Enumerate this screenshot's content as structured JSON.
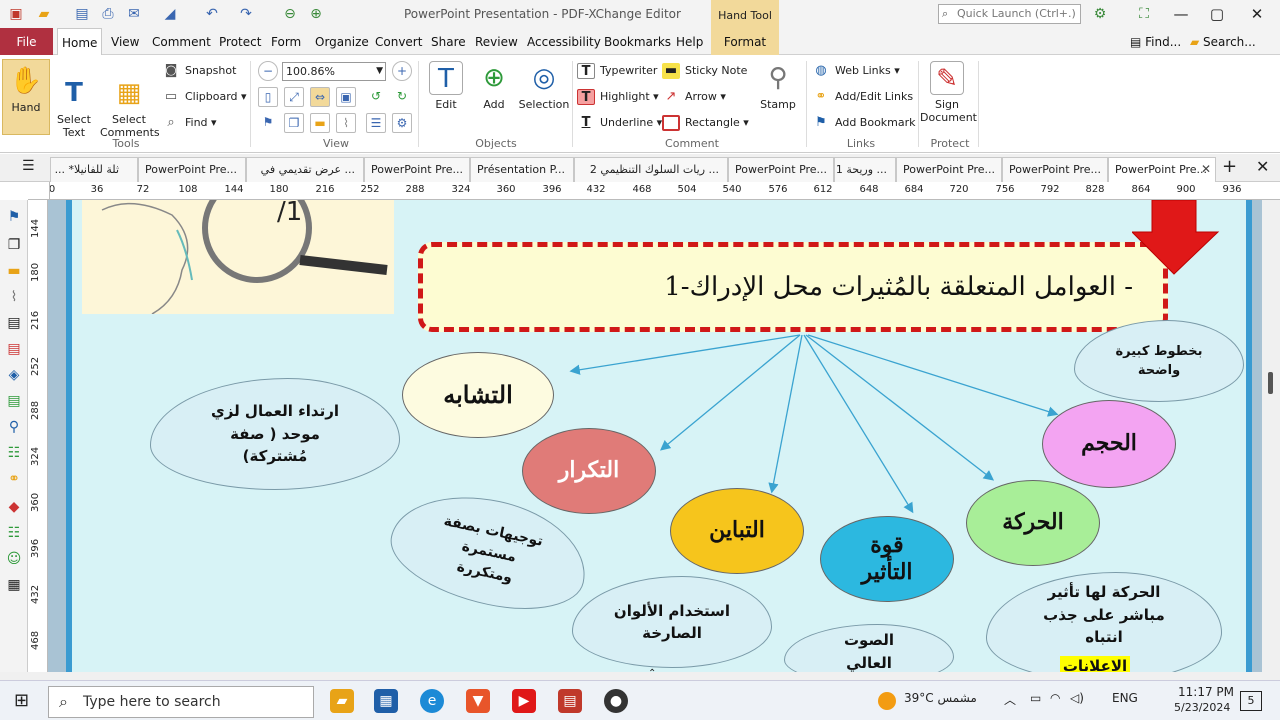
{
  "window": {
    "title": "PowerPoint Presentation - PDF-XChange Editor",
    "context_tab_header": "Hand Tool",
    "quick_launch_placeholder": "Quick Launch (Ctrl+.)"
  },
  "menu": [
    "File",
    "Home",
    "View",
    "Comment",
    "Protect",
    "Form",
    "Organize",
    "Convert",
    "Share",
    "Review",
    "Accessibility",
    "Bookmarks",
    "Help",
    "Format"
  ],
  "menu_right": {
    "find": "Find...",
    "search": "Search..."
  },
  "ribbon": {
    "hand": "Hand",
    "select_text": "Select\nText",
    "select_comments": "Select\nComments",
    "snapshot": "Snapshot",
    "clipboard": "Clipboard",
    "find": "Find",
    "zoom": "100.86%",
    "edit": "Edit",
    "add": "Add",
    "selection": "Selection",
    "typewriter": "Typewriter",
    "sticky_note": "Sticky Note",
    "highlight": "Highlight",
    "arrow": "Arrow",
    "underline": "Underline",
    "rectangle": "Rectangle",
    "stamp": "Stamp",
    "web_links": "Web Links",
    "add_edit_links": "Add/Edit Links",
    "add_bookmark": "Add Bookmark",
    "sign_document": "Sign\nDocument",
    "groups": {
      "tools": "Tools",
      "view": "View",
      "objects": "Objects",
      "comment": "Comment",
      "links": "Links",
      "protect": "Protect"
    }
  },
  "doc_tabs": [
    "ثلة للفانيلا* ...",
    "PowerPoint Pre...",
    "... عرض تقديمي في",
    "PowerPoint Pre...",
    "Présentation P...",
    "... ريات السلوك التنظيمي 2",
    "PowerPoint Pre...",
    "... وريحة 1",
    "PowerPoint Pre...",
    "PowerPoint Pre...",
    "PowerPoint Pre..."
  ],
  "ruler_h": [
    "0",
    "36",
    "72",
    "108",
    "144",
    "180",
    "216",
    "252",
    "288",
    "324",
    "360",
    "396",
    "432",
    "468",
    "504",
    "540",
    "576",
    "612",
    "648",
    "684",
    "720",
    "756",
    "792",
    "828",
    "864",
    "900",
    "936"
  ],
  "ruler_v": [
    "144",
    "180",
    "216",
    "252",
    "288",
    "324",
    "360",
    "396",
    "432",
    "468"
  ],
  "slide": {
    "title": "1-العوامل المتعلقة بالمُثيرات محل الإدراك -",
    "ovals": [
      {
        "text": "التشابه",
        "color": "#fdfbe0"
      },
      {
        "text": "التكرار",
        "color": "#e07b78"
      },
      {
        "text": "التباين",
        "color": "#f6c51c"
      },
      {
        "text": "قوة التأثير",
        "color": "#2cb8e0"
      },
      {
        "text": "الحركة",
        "color": "#a8ee98"
      },
      {
        "text": "الحجم",
        "color": "#f3a4f2"
      }
    ],
    "clouds": [
      {
        "text": "ارتداء العمال لزي موحد ( صفة مُشتركة)"
      },
      {
        "text": "توجيهات بصفة مستمرة ومتكررة"
      },
      {
        "text": "استخدام الألوان الصارخة"
      },
      {
        "text": "الصوت العالي"
      },
      {
        "text": "بخطوط كبيرة واضحة"
      },
      {
        "text": "الحركة لها تأثير مباشر على جذب انتباه"
      },
      {
        "text": "الاعلانات"
      }
    ]
  },
  "taskbar": {
    "search_placeholder": "Type here to search",
    "weather": "39°C  مشمس",
    "lang": "ENG",
    "time": "11:17 PM",
    "date": "5/23/2024",
    "notifications": "5"
  }
}
